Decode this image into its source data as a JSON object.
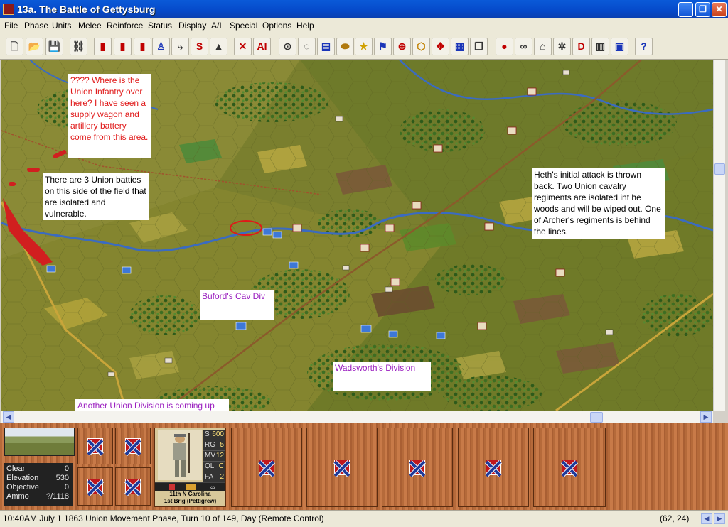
{
  "window": {
    "title": "13a. The Battle of Gettysburg"
  },
  "menu": [
    "File",
    "Phase",
    "Units",
    "Melee",
    "Reinforce",
    "Status",
    "Display",
    "A/I",
    "Special",
    "Options",
    "Help"
  ],
  "toolbar": {
    "icons": [
      "new-icon",
      "open-icon",
      "save-icon",
      "link-icon",
      "unit-a-icon",
      "unit-b-icon",
      "unit-c-icon",
      "soldier-icon",
      "cannon-icon",
      "S",
      "pyramid-icon",
      "cross-arms-icon",
      "AI",
      "pin-icon",
      "bulb-icon",
      "document-icon",
      "hat-icon",
      "star-icon",
      "flag-icon",
      "target-icon",
      "hex-icon",
      "move-icon",
      "map-icon",
      "stack-icon",
      "rec-icon",
      "binoculars-icon",
      "tent-icon",
      "gear-icon",
      "D",
      "scroll-icon",
      "panel-icon",
      "?"
    ]
  },
  "notes": {
    "union_infantry": "????  Where is the Union Infantry over here?  I have seen a supply wagon and artillery battery come from this area.",
    "batteries": "There are 3 Union batties on this side of the field that are isolated and vulnerable.",
    "heth": "Heth's initial attack is thrown back.  Two Union cavalry regiments are isolated int he woods and will be wiped out.  One of Archer's regiments is behind the lines.",
    "buford": "Buford's Cav Div",
    "wadsworth": "Wadsworth's Division",
    "another_division": "Another Union Division is coming up through Gettysburg."
  },
  "terrain": {
    "type": "Clear",
    "type_value": "0",
    "elevation_label": "Elevation",
    "elevation": "530",
    "objective_label": "Objective",
    "objective": "0",
    "ammo_label": "Ammo",
    "ammo": "?/1118"
  },
  "unit": {
    "stats": [
      {
        "label": "S",
        "value": "600"
      },
      {
        "label": "RG",
        "value": "5"
      },
      {
        "label": "MV",
        "value": "12"
      },
      {
        "label": "QL",
        "value": "C"
      },
      {
        "label": "FA",
        "value": "2"
      }
    ],
    "name_line1": "11th N Carolina",
    "name_line2": "1st Brig (Pettigrew)"
  },
  "status": {
    "text": "10:40AM July 1 1863 Union Movement Phase, Turn 10 of 149, Day (Remote Control)",
    "coords": "(62, 24)"
  }
}
